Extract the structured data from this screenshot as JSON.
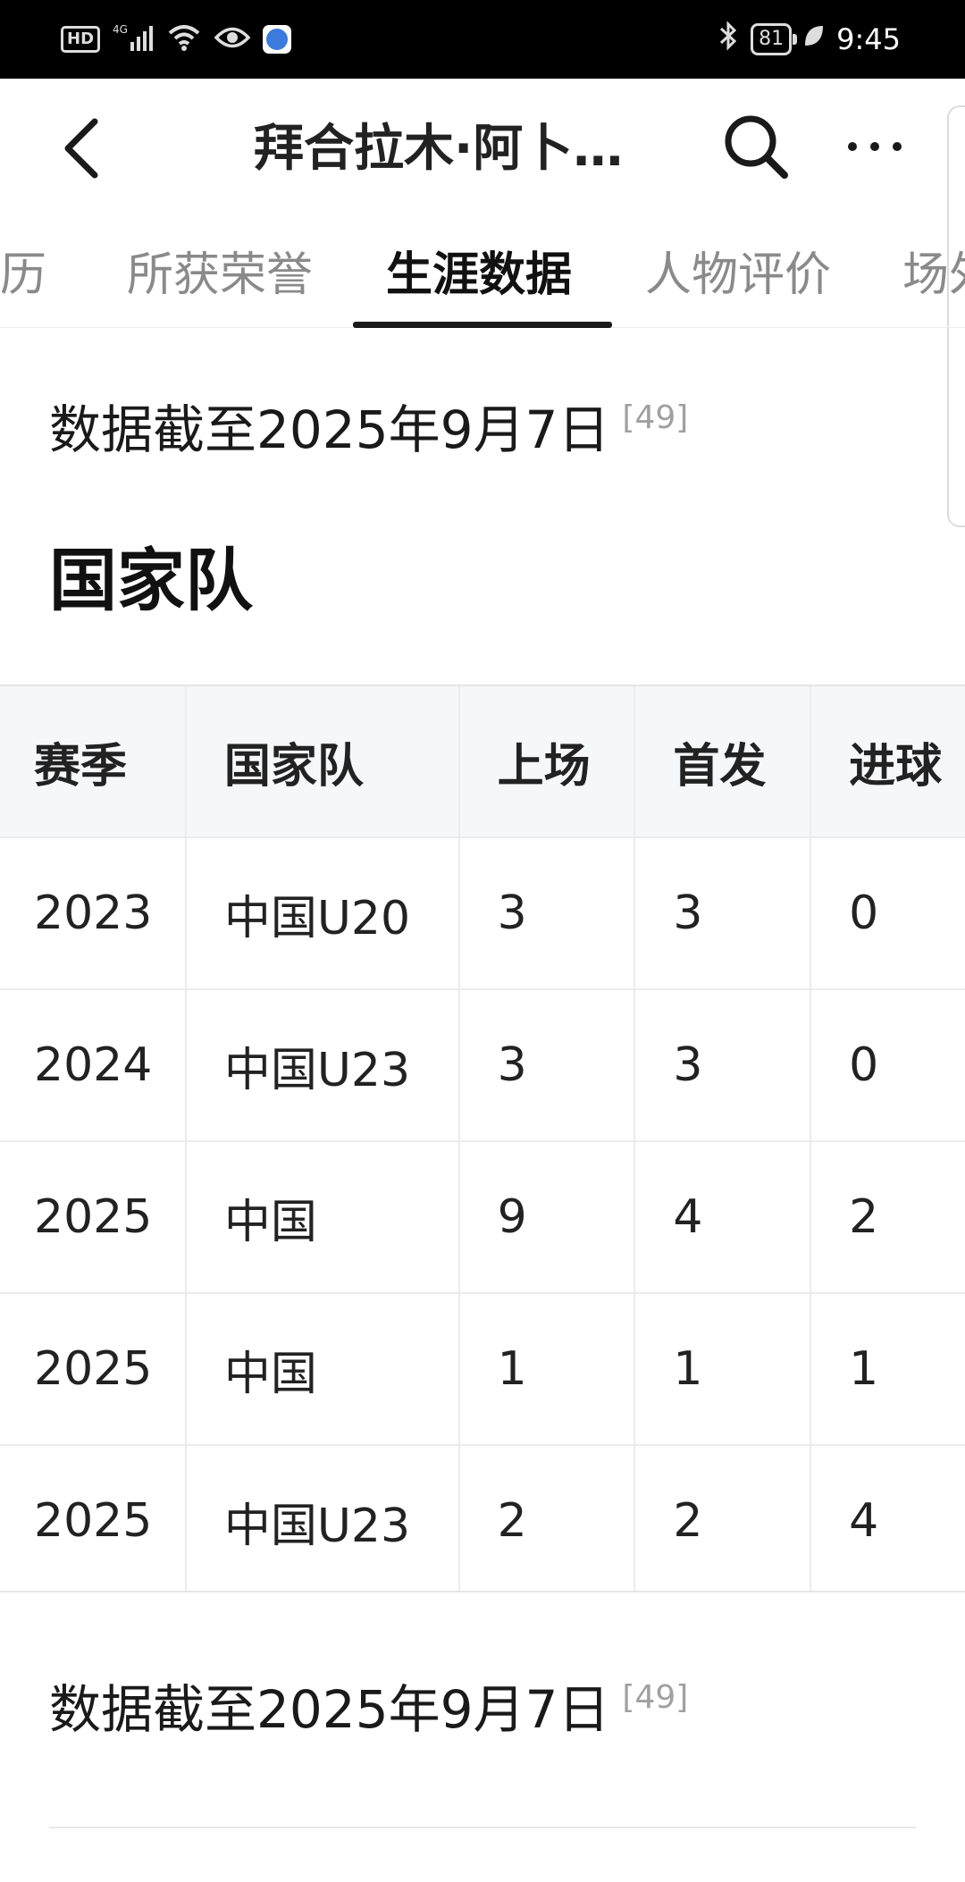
{
  "status_bar": {
    "hd": "HD",
    "network": "4G",
    "battery": "81",
    "time": "9:45"
  },
  "header": {
    "title": "拜合拉木·阿卜…"
  },
  "tabs": [
    {
      "label": "经历"
    },
    {
      "label": "所获荣誉"
    },
    {
      "label": "生涯数据"
    },
    {
      "label": "人物评价"
    },
    {
      "label": "场外"
    }
  ],
  "note_top": {
    "text": "数据截至2025年9月7日",
    "ref": "[49]"
  },
  "section": {
    "title": "国家队"
  },
  "table": {
    "headers": [
      "赛季",
      "国家队",
      "上场",
      "首发",
      "进球"
    ],
    "rows": [
      [
        "2023",
        "中国U20",
        "3",
        "3",
        "0"
      ],
      [
        "2024",
        "中国U23",
        "3",
        "3",
        "0"
      ],
      [
        "2025",
        "中国",
        "9",
        "4",
        "2"
      ],
      [
        "2025",
        "中国",
        "1",
        "1",
        "1"
      ],
      [
        "2025",
        "中国U23",
        "2",
        "2",
        "4"
      ]
    ]
  },
  "note_bottom": {
    "text": "数据截至2025年9月7日",
    "ref": "[49]"
  }
}
